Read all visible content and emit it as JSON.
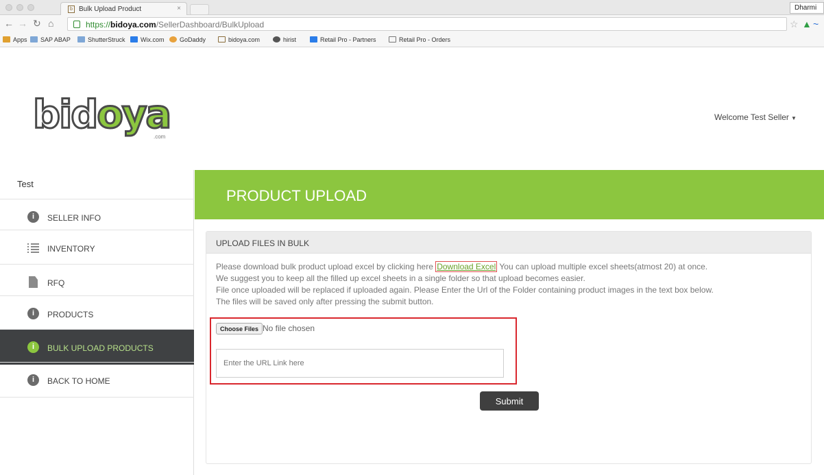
{
  "browser": {
    "tab_title": "Bulk Upload Product",
    "tab_close": "×",
    "profile_name": "Dharmi",
    "url_scheme": "https://",
    "url_host": "bidoya.com",
    "url_path": "/SellerDashboard/BulkUpload",
    "bookmarks": [
      "Apps",
      "SAP ABAP",
      "ShutterStruck",
      "Wix.com",
      "GoDaddy",
      "bidoya.com",
      "hirist",
      "Retail Pro - Partners",
      "Retail Pro - Orders"
    ]
  },
  "header": {
    "logo_text_dark": "bid",
    "logo_text_green": "oya",
    "logo_suffix": ".com",
    "welcome": "Welcome Test Seller"
  },
  "sidebar": {
    "title": "Test",
    "items": [
      {
        "label": "SELLER INFO",
        "icon": "info-icon"
      },
      {
        "label": "INVENTORY",
        "icon": "list-icon"
      },
      {
        "label": "RFQ",
        "icon": "document-icon"
      },
      {
        "label": "PRODUCTS",
        "icon": "info-icon"
      },
      {
        "label": "BULK UPLOAD PRODUCTS",
        "icon": "info-icon",
        "active": true
      },
      {
        "label": "BACK TO HOME",
        "icon": "info-icon"
      }
    ]
  },
  "main": {
    "banner_title": "PRODUCT UPLOAD",
    "panel_title": "UPLOAD FILES IN BULK",
    "instr_1a": "Please download bulk product upload excel by clicking here",
    "download_link": "Download Excel",
    "instr_1b": "You can upload multiple excel sheets(atmost 20) at once.",
    "instr_2": "We suggest you to keep all the filled up excel sheets in a single folder so that upload becomes easier.",
    "instr_3": "File once uploaded will be replaced if uploaded again. Please Enter the Url of the Folder containing product images in the text box below.",
    "instr_4": "The files will be saved only after pressing the submit button.",
    "choose_files": "Choose Files",
    "no_file": "No file chosen",
    "url_placeholder": "Enter the URL Link here",
    "submit": "Submit"
  },
  "colors": {
    "brand_green": "#8cc63f",
    "active_bg": "#3f4143",
    "highlight_red": "#d9262d"
  }
}
